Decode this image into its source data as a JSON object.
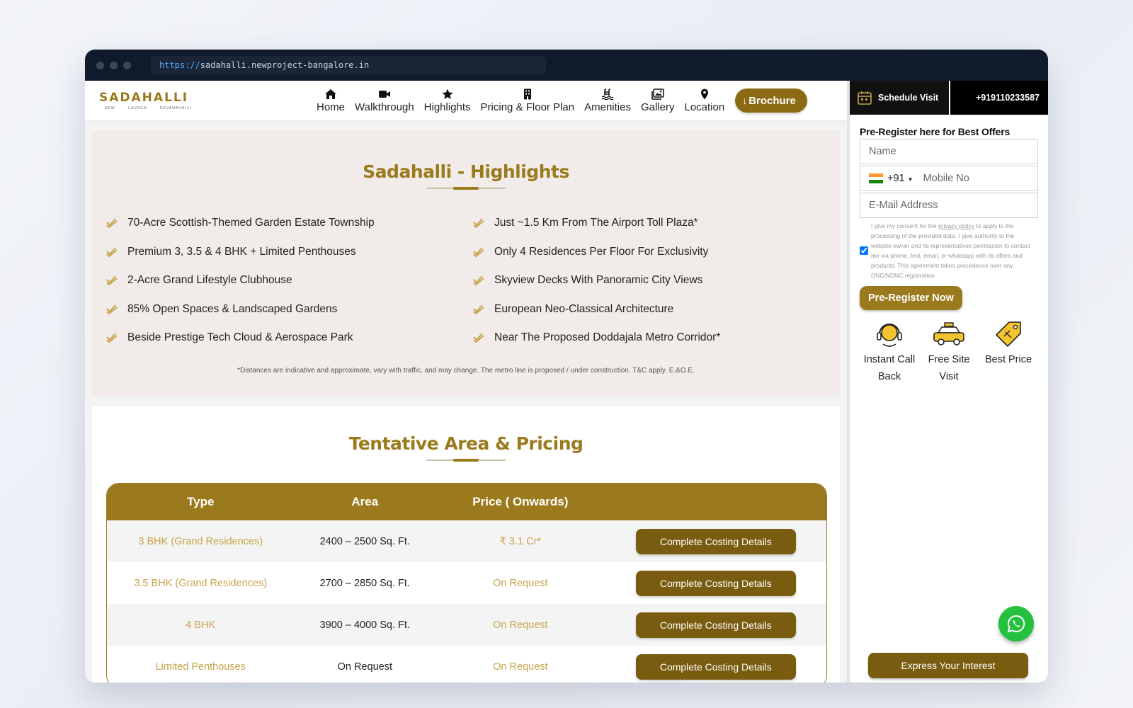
{
  "browser": {
    "url_scheme": "https://",
    "url_rest": "sadahalli.newproject-bangalore.in"
  },
  "logo": {
    "name": "SADAHALLI",
    "sub": "NEW LAUNCH DEVANAHALLI"
  },
  "nav": {
    "items": [
      {
        "label": "Home",
        "icon": "home-icon"
      },
      {
        "label": "Walkthrough",
        "icon": "video-icon"
      },
      {
        "label": "Highlights",
        "icon": "star-icon"
      },
      {
        "label": "Pricing & Floor Plan",
        "icon": "building-icon"
      },
      {
        "label": "Amenities",
        "icon": "pool-icon"
      },
      {
        "label": "Gallery",
        "icon": "images-icon"
      },
      {
        "label": "Location",
        "icon": "map-pin-icon"
      }
    ],
    "brochure_label": "Brochure"
  },
  "highlights": {
    "title": "Sadahalli - Highlights",
    "left": [
      "70-Acre Scottish-Themed Garden Estate Township",
      "Premium 3, 3.5 & 4 BHK + Limited Penthouses",
      "2-Acre Grand Lifestyle Clubhouse",
      "85% Open Spaces & Landscaped Gardens",
      "Beside Prestige Tech Cloud & Aerospace Park"
    ],
    "right": [
      "Just ~1.5 Km From The Airport Toll Plaza*",
      "Only 4 Residences Per Floor For Exclusivity",
      "Skyview Decks With Panoramic City Views",
      "European Neo-Classical Architecture",
      "Near The Proposed Doddajala Metro Corridor*"
    ],
    "disclaimer": "*Distances are indicative and approximate, vary with traffic, and may change. The metro line is proposed / under construction. T&C apply. E.&O.E."
  },
  "pricing": {
    "title": "Tentative Area & Pricing",
    "headers": [
      "Type",
      "Area",
      "Price ( Onwards)"
    ],
    "rows": [
      {
        "type": "3 BHK (Grand Residences)",
        "area": "2400 – 2500 Sq. Ft.",
        "price": "₹ 3.1 Cr*",
        "button": "Complete Costing Details"
      },
      {
        "type": "3.5 BHK (Grand Residences)",
        "area": "2700 – 2850 Sq. Ft.",
        "price": "On Request",
        "button": "Complete Costing Details"
      },
      {
        "type": "4 BHK",
        "area": "3900 – 4000 Sq. Ft.",
        "price": "On Request",
        "button": "Complete Costing Details"
      },
      {
        "type": "Limited Penthouses",
        "area": "On Request",
        "price": "On Request",
        "button": "Complete Costing Details"
      }
    ]
  },
  "sidebar": {
    "schedule_label": "Schedule Visit",
    "phone": "+919110233587",
    "heading": "Pre-Register here for Best Offers",
    "name_placeholder": "Name",
    "country_code": "+91",
    "mobile_placeholder": "Mobile No",
    "email_placeholder": "E-Mail Address",
    "consent_pre": "I give my consent for the ",
    "consent_link": "privacy policy",
    "consent_post": " to apply to the processing of the provided data. I give authority to the website owner and its representatives permission to contact me via phone, text, email, or whatsapp with its offers and products. This agreement takes precedence over any DNC/NDNC registration.",
    "consent_checked": true,
    "submit_label": "Pre-Register Now",
    "perks": [
      {
        "label": "Instant Call Back",
        "icon": "headset-icon"
      },
      {
        "label": "Free Site Visit",
        "icon": "taxi-icon"
      },
      {
        "label": "Best Price",
        "icon": "price-tag-icon"
      }
    ],
    "express_label": "Express Your Interest"
  },
  "colors": {
    "brand_gold": "#9a7a1c",
    "button_brown": "#7a5c10",
    "whatsapp_green": "#23c13d"
  }
}
